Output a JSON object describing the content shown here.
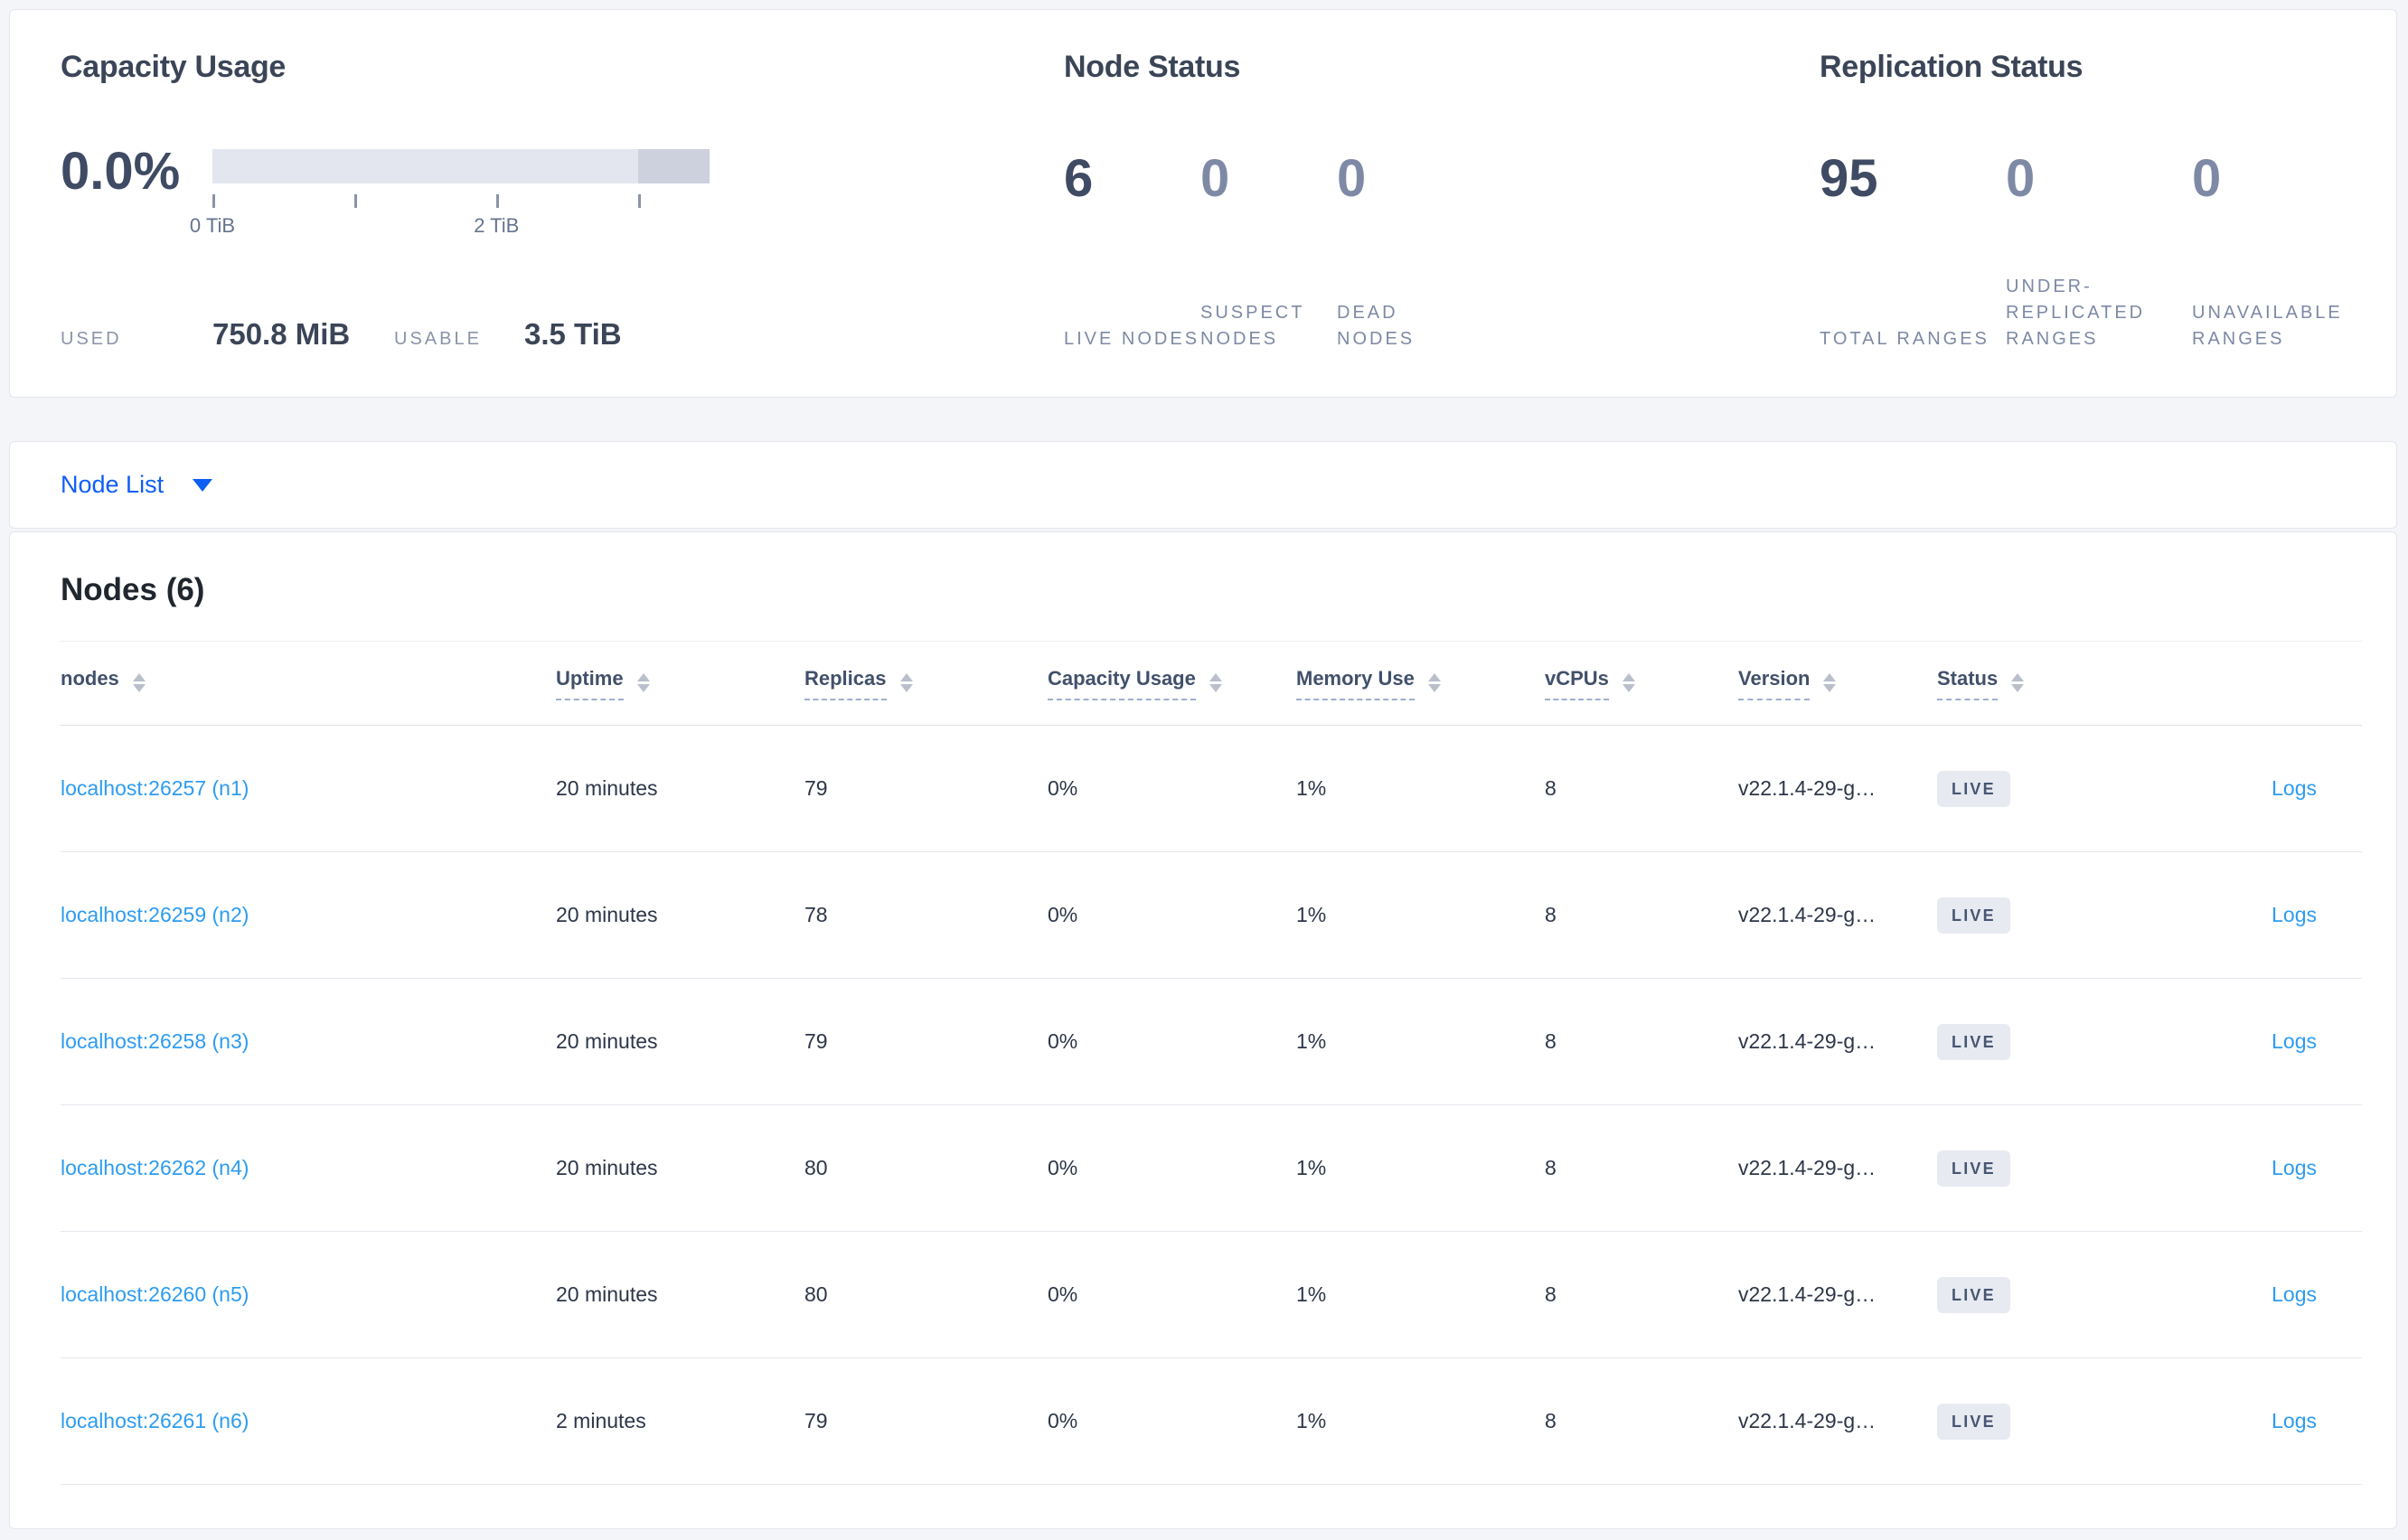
{
  "colors": {
    "page_background": "#f4f5f9",
    "accent_blue": "#0d5ef5",
    "link_blue": "#2d9cf0",
    "dark_slate": "#3f4a63",
    "muted_slate": "#7e8aa5",
    "bar_track": "#e4e6ef",
    "bar_dark_segment": "#cdd1de",
    "badge_background": "#e7eaf1"
  },
  "summary": {
    "capacity": {
      "title": "Capacity Usage",
      "percent": "0.0%",
      "bar": {
        "total_tib": 3.5,
        "dark_from_tib": 3.0,
        "ticks": [
          {
            "tib": 0,
            "label": "0 TiB"
          },
          {
            "tib": 1,
            "label": ""
          },
          {
            "tib": 2,
            "label": "2 TiB"
          },
          {
            "tib": 3,
            "label": ""
          }
        ]
      },
      "metrics": [
        {
          "label": "USED",
          "value": "750.8 MiB"
        },
        {
          "label": "USABLE",
          "value": "3.5 TiB"
        }
      ]
    },
    "node_status": {
      "title": "Node Status",
      "stats": [
        {
          "value": "6",
          "label": "LIVE NODES",
          "muted": false
        },
        {
          "value": "0",
          "label": "SUSPECT NODES",
          "muted": true
        },
        {
          "value": "0",
          "label": "DEAD NODES",
          "muted": true
        }
      ]
    },
    "replication": {
      "title": "Replication Status",
      "stats": [
        {
          "value": "95",
          "label": "TOTAL RANGES",
          "muted": false
        },
        {
          "value": "0",
          "label": "UNDER-REPLICATED RANGES",
          "muted": true
        },
        {
          "value": "0",
          "label": "UNAVAILABLE RANGES",
          "muted": true
        }
      ]
    }
  },
  "view_selector": {
    "label": "Node List",
    "caret_icon": "chevron-down"
  },
  "nodes_section": {
    "heading": "Nodes (6)"
  },
  "table": {
    "columns": [
      {
        "key": "address",
        "label": "nodes",
        "sortable": true,
        "underline": false
      },
      {
        "key": "uptime",
        "label": "Uptime",
        "sortable": true,
        "underline": true
      },
      {
        "key": "replicas",
        "label": "Replicas",
        "sortable": true,
        "underline": true
      },
      {
        "key": "capacity_usage",
        "label": "Capacity Usage",
        "sortable": true,
        "underline": true
      },
      {
        "key": "memory_use",
        "label": "Memory Use",
        "sortable": true,
        "underline": true
      },
      {
        "key": "vcpus",
        "label": "vCPUs",
        "sortable": true,
        "underline": true
      },
      {
        "key": "version",
        "label": "Version",
        "sortable": true,
        "underline": true
      },
      {
        "key": "status",
        "label": "Status",
        "sortable": true,
        "underline": true
      },
      {
        "key": "logs",
        "label": "",
        "sortable": false,
        "underline": false
      }
    ],
    "rows": [
      {
        "address": "localhost:26257 (n1)",
        "uptime": "20 minutes",
        "replicas": "79",
        "capacity_usage": "0%",
        "memory_use": "1%",
        "vcpus": "8",
        "version": "v22.1.4-29-g…",
        "status": "LIVE",
        "logs": "Logs"
      },
      {
        "address": "localhost:26259 (n2)",
        "uptime": "20 minutes",
        "replicas": "78",
        "capacity_usage": "0%",
        "memory_use": "1%",
        "vcpus": "8",
        "version": "v22.1.4-29-g…",
        "status": "LIVE",
        "logs": "Logs"
      },
      {
        "address": "localhost:26258 (n3)",
        "uptime": "20 minutes",
        "replicas": "79",
        "capacity_usage": "0%",
        "memory_use": "1%",
        "vcpus": "8",
        "version": "v22.1.4-29-g…",
        "status": "LIVE",
        "logs": "Logs"
      },
      {
        "address": "localhost:26262 (n4)",
        "uptime": "20 minutes",
        "replicas": "80",
        "capacity_usage": "0%",
        "memory_use": "1%",
        "vcpus": "8",
        "version": "v22.1.4-29-g…",
        "status": "LIVE",
        "logs": "Logs"
      },
      {
        "address": "localhost:26260 (n5)",
        "uptime": "20 minutes",
        "replicas": "80",
        "capacity_usage": "0%",
        "memory_use": "1%",
        "vcpus": "8",
        "version": "v22.1.4-29-g…",
        "status": "LIVE",
        "logs": "Logs"
      },
      {
        "address": "localhost:26261 (n6)",
        "uptime": "2 minutes",
        "replicas": "79",
        "capacity_usage": "0%",
        "memory_use": "1%",
        "vcpus": "8",
        "version": "v22.1.4-29-g…",
        "status": "LIVE",
        "logs": "Logs"
      }
    ]
  }
}
